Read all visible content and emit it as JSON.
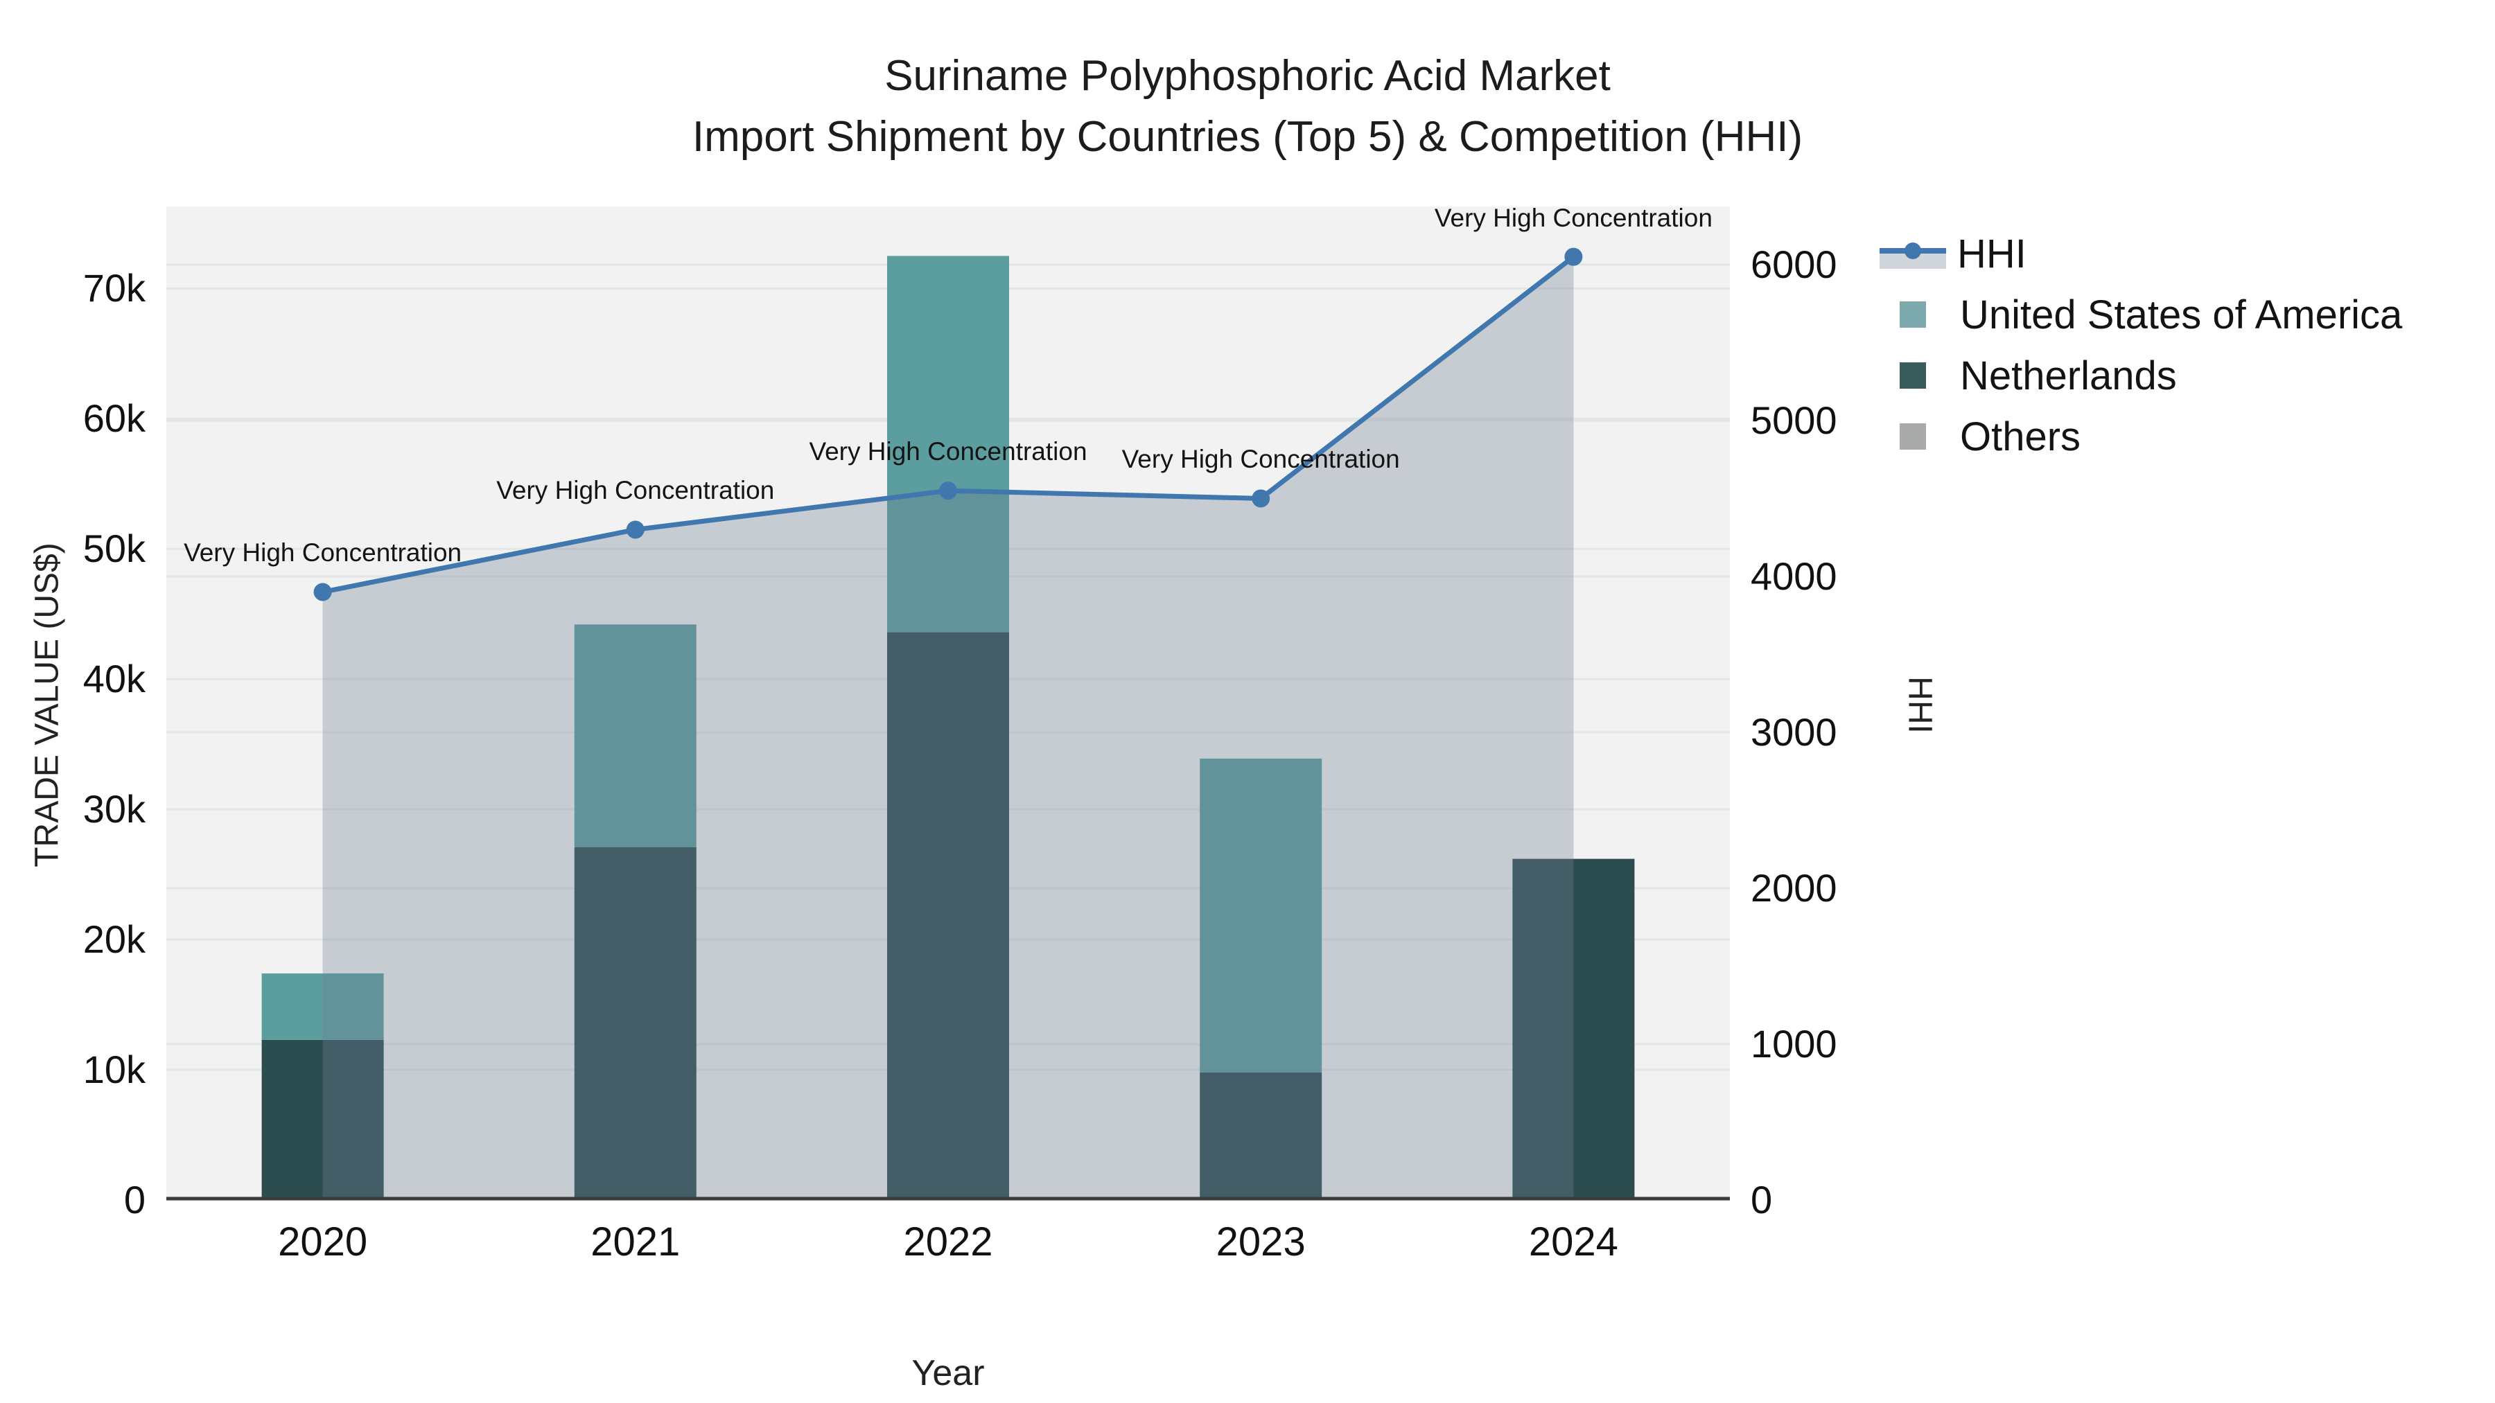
{
  "title": {
    "line1": "Suriname Polyphosphoric Acid Market",
    "line2": "Import Shipment by Countries (Top 5) & Competition (HHI)"
  },
  "axes": {
    "x_title": "Year",
    "y_left_title": "TRADE VALUE (US$)",
    "y_right_title": "HHI",
    "y_left_ticks": [
      "0",
      "10k",
      "20k",
      "30k",
      "40k",
      "50k",
      "60k",
      "70k"
    ],
    "y_right_ticks": [
      "0",
      "1000",
      "2000",
      "3000",
      "4000",
      "5000",
      "6000"
    ],
    "x_ticks": [
      "2020",
      "2021",
      "2022",
      "2023",
      "2024"
    ]
  },
  "legend": {
    "items": [
      {
        "label": "HHI",
        "type": "line"
      },
      {
        "label": "United States of America",
        "type": "swatch",
        "color_key": "usa"
      },
      {
        "label": "Netherlands",
        "type": "swatch",
        "color_key": "netherlands"
      },
      {
        "label": "Others",
        "type": "swatch",
        "color_key": "others"
      }
    ]
  },
  "colors": {
    "usa": "#5C9D9F",
    "usa_legend": "#7DAAAC",
    "netherlands": "#2C4D4F",
    "netherlands_legend": "#3A5B5C",
    "others": "#A9ABAB",
    "hhi_line": "#3F77AE",
    "hhi_fill": "rgba(113,126,149,0.33)",
    "plot_bg": "#F1F2F1",
    "grid": "#E4E6E6",
    "axis_line": "#3C3C3C",
    "text": "#1A1A1A"
  },
  "chart_data": {
    "type": "bar",
    "subtype": "stacked-bars-with-line",
    "title": "Suriname Polyphosphoric Acid Market Import Shipment by Countries (Top 5) & Competition (HHI)",
    "categories": [
      2020,
      2021,
      2022,
      2023,
      2024
    ],
    "series": [
      {
        "name": "United States of America",
        "type": "bar",
        "values": [
          5100,
          17100,
          28900,
          24100,
          0
        ]
      },
      {
        "name": "Netherlands",
        "type": "bar",
        "values": [
          12300,
          27100,
          43600,
          9800,
          26200
        ]
      },
      {
        "name": "Others",
        "type": "bar",
        "values": [
          0,
          0,
          0,
          0,
          0
        ]
      }
    ],
    "line_series": {
      "name": "HHI",
      "axis": "right",
      "fill": "tozeroy",
      "values": [
        3900,
        4300,
        4550,
        4500,
        6050
      ]
    },
    "annotations": [
      {
        "x": 2020,
        "text": "Very High Concentration"
      },
      {
        "x": 2021,
        "text": "Very High Concentration"
      },
      {
        "x": 2022,
        "text": "Very High Concentration"
      },
      {
        "x": 2023,
        "text": "Very High Concentration"
      },
      {
        "x": 2024,
        "text": "Very High Concentration"
      }
    ],
    "xlabel": "Year",
    "ylabel": "TRADE VALUE (US$)",
    "ylabel_right": "HHI",
    "ylim_left": [
      0,
      76300
    ],
    "ylim_right": [
      0,
      6373
    ],
    "grid": true,
    "legend_position": "right"
  }
}
